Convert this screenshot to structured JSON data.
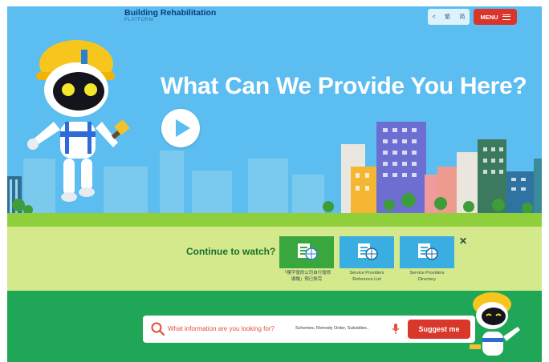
{
  "header": {
    "brand_title": "Building Rehabilitation",
    "brand_subtitle": "PLATFORM",
    "tools": [
      "<",
      "繁",
      "简"
    ],
    "menu_label": "MENU"
  },
  "hero": {
    "headline": "What Can We Provide You Here?"
  },
  "continue_watch": {
    "label": "Continue to watch?",
    "items": [
      {
        "caption": "「樓宇復修公司自行復修\n導讀」預已設完",
        "color": "#3aa63e"
      },
      {
        "caption": "Service Providers\nReference List",
        "color": "#3aaee0"
      },
      {
        "caption": "Service Providers\nDirectory",
        "color": "#3aaee0"
      }
    ]
  },
  "search": {
    "prompt": "What information are you looking for?",
    "hint": "Schemes, Remedy Order, Subsidies..",
    "button_label": "Suggest me"
  },
  "colors": {
    "sky": "#5bbdf0",
    "grass": "#8fcf3c",
    "footer_green": "#1fa657",
    "accent_red": "#d9352b"
  }
}
